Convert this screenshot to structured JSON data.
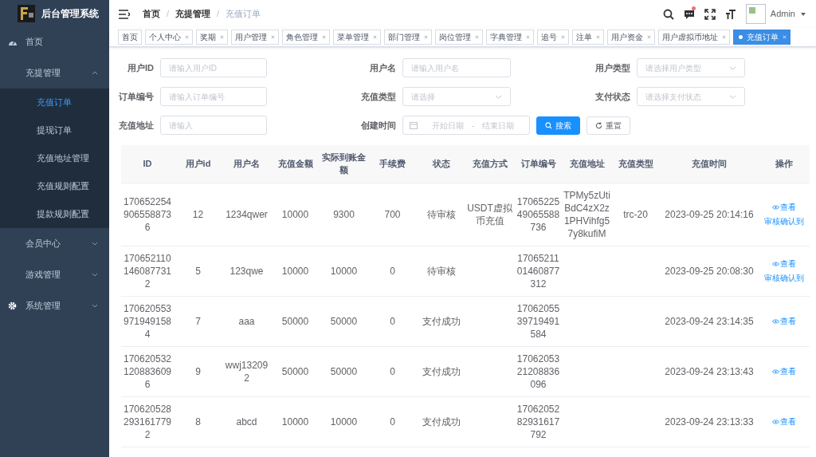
{
  "sidebar": {
    "title": "后台管理系统",
    "menu": [
      {
        "label": "首页",
        "kind": "link",
        "selected": false
      },
      {
        "label": "充提管理",
        "kind": "group",
        "expanded": true,
        "selected": false,
        "children": [
          {
            "label": "充值订单",
            "selected": true
          },
          {
            "label": "提现订单",
            "selected": false
          },
          {
            "label": "充值地址管理",
            "selected": false
          },
          {
            "label": "充值规则配置",
            "selected": false
          },
          {
            "label": "提款规则配置",
            "selected": false
          }
        ]
      },
      {
        "label": "会员中心",
        "kind": "group",
        "expanded": false,
        "selected": false
      },
      {
        "label": "游戏管理",
        "kind": "group",
        "expanded": false,
        "selected": false
      },
      {
        "label": "系统管理",
        "kind": "group",
        "expanded": false,
        "selected": false
      }
    ]
  },
  "header": {
    "breadcrumb": [
      "首页",
      "充提管理",
      "充值订单"
    ],
    "breadcrumb_separator": "/",
    "has_new_message": true,
    "user": "Admin"
  },
  "tags": [
    {
      "label": "首页",
      "closable": false,
      "selected": false
    },
    {
      "label": "个人中心",
      "closable": true,
      "selected": false
    },
    {
      "label": "奖期",
      "closable": true,
      "selected": false
    },
    {
      "label": "用户管理",
      "closable": true,
      "selected": false
    },
    {
      "label": "角色管理",
      "closable": true,
      "selected": false
    },
    {
      "label": "菜单管理",
      "closable": true,
      "selected": false
    },
    {
      "label": "部门管理",
      "closable": true,
      "selected": false
    },
    {
      "label": "岗位管理",
      "closable": true,
      "selected": false
    },
    {
      "label": "字典管理",
      "closable": true,
      "selected": false
    },
    {
      "label": "追号",
      "closable": true,
      "selected": false
    },
    {
      "label": "注单",
      "closable": true,
      "selected": false
    },
    {
      "label": "用户资金",
      "closable": true,
      "selected": false
    },
    {
      "label": "用户虚拟币地址",
      "closable": true,
      "selected": false
    },
    {
      "label": "充值订单",
      "closable": true,
      "selected": true
    }
  ],
  "filters": [
    {
      "label": "用户ID",
      "kind": "input",
      "placeholder": "请输入用户ID"
    },
    {
      "label": "用户名",
      "kind": "input",
      "placeholder": "请输入用户名"
    },
    {
      "label": "用户类型",
      "kind": "select",
      "placeholder": "请选择用户类型"
    },
    {
      "label": "订单编号",
      "kind": "input",
      "placeholder": "请输入订单编号"
    },
    {
      "label": "充值类型",
      "kind": "select",
      "placeholder": "请选择"
    },
    {
      "label": "支付状态",
      "kind": "select",
      "placeholder": "请选择支付状态"
    },
    {
      "label": "充值地址",
      "kind": "input",
      "placeholder": "请输入"
    },
    {
      "label": "创建时间",
      "kind": "daterange",
      "placeholder": "开始日期",
      "range_separator": "-",
      "end_placeholder": "结束日期"
    }
  ],
  "buttons": [
    {
      "label": "搜索",
      "kind": "primary"
    },
    {
      "label": "重置",
      "kind": "default"
    }
  ],
  "table": {
    "columns": [
      "ID",
      "用户id",
      "用户名",
      "充值金额",
      "实际到账金额",
      "手续费",
      "状态",
      "充值方式",
      "订单编号",
      "充值地址",
      "充值类型",
      "充值时间",
      "操作"
    ],
    "rows": [
      {
        "cells": [
          "1706522549065588736",
          "12",
          "1234qwer",
          "10000",
          "9300",
          "700",
          "待审核",
          "USDT虚拟币充值",
          "1706522549065588736",
          "TPMy5zUtiBdC4zX2z1PHVihfg57y8kufiM",
          "trc-20",
          "2023-09-25 20:14:16"
        ],
        "actions": [
          "查看",
          "审核确认到"
        ]
      },
      {
        "cells": [
          "1706521101460877312",
          "5",
          "123qwe",
          "10000",
          "10000",
          "0",
          "待审核",
          "",
          "1706521101460877312",
          "",
          "",
          "2023-09-25 20:08:30"
        ],
        "actions": [
          "查看",
          "审核确认到"
        ]
      },
      {
        "cells": [
          "1706205539719491584",
          "7",
          "aaa",
          "50000",
          "50000",
          "0",
          "支付成功",
          "",
          "1706205539719491584",
          "",
          "",
          "2023-09-24 23:14:35"
        ],
        "actions": [
          "查看"
        ]
      },
      {
        "cells": [
          "1706205321208836096",
          "9",
          "wwj132092",
          "50000",
          "50000",
          "0",
          "支付成功",
          "",
          "1706205321208836096",
          "",
          "",
          "2023-09-24 23:13:43"
        ],
        "actions": [
          "查看"
        ]
      },
      {
        "cells": [
          "1706205282931617792",
          "8",
          "abcd",
          "10000",
          "10000",
          "0",
          "支付成功",
          "",
          "1706205282931617792",
          "",
          "",
          "2023-09-24 23:13:33"
        ],
        "actions": [
          "查看"
        ]
      }
    ]
  }
}
